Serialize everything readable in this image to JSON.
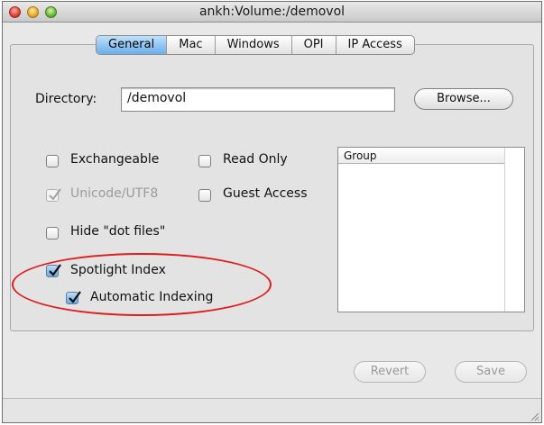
{
  "window": {
    "title": "ankh:Volume:/demovol"
  },
  "tabs": [
    {
      "label": "General",
      "active": true
    },
    {
      "label": "Mac",
      "active": false
    },
    {
      "label": "Windows",
      "active": false
    },
    {
      "label": "OPI",
      "active": false
    },
    {
      "label": "IP Access",
      "active": false
    }
  ],
  "directory": {
    "label": "Directory:",
    "value": "/demovol",
    "browse_label": "Browse..."
  },
  "options": {
    "exchangeable": {
      "label": "Exchangeable",
      "checked": false,
      "enabled": true
    },
    "read_only": {
      "label": "Read Only",
      "checked": false,
      "enabled": true
    },
    "unicode_utf8": {
      "label": "Unicode/UTF8",
      "checked": true,
      "enabled": false
    },
    "guest_access": {
      "label": "Guest Access",
      "checked": false,
      "enabled": true
    },
    "hide_dot_files": {
      "label": "Hide \"dot files\"",
      "checked": false,
      "enabled": true
    },
    "spotlight_index": {
      "label": "Spotlight Index",
      "checked": true,
      "enabled": true
    },
    "automatic_indexing": {
      "label": "Automatic Indexing",
      "checked": true,
      "enabled": true
    }
  },
  "group_list": {
    "header": "Group"
  },
  "buttons": {
    "revert_label": "Revert",
    "save_label": "Save"
  },
  "colors": {
    "highlight": "#e01c1c",
    "selected_tab": "#6aaeea"
  }
}
